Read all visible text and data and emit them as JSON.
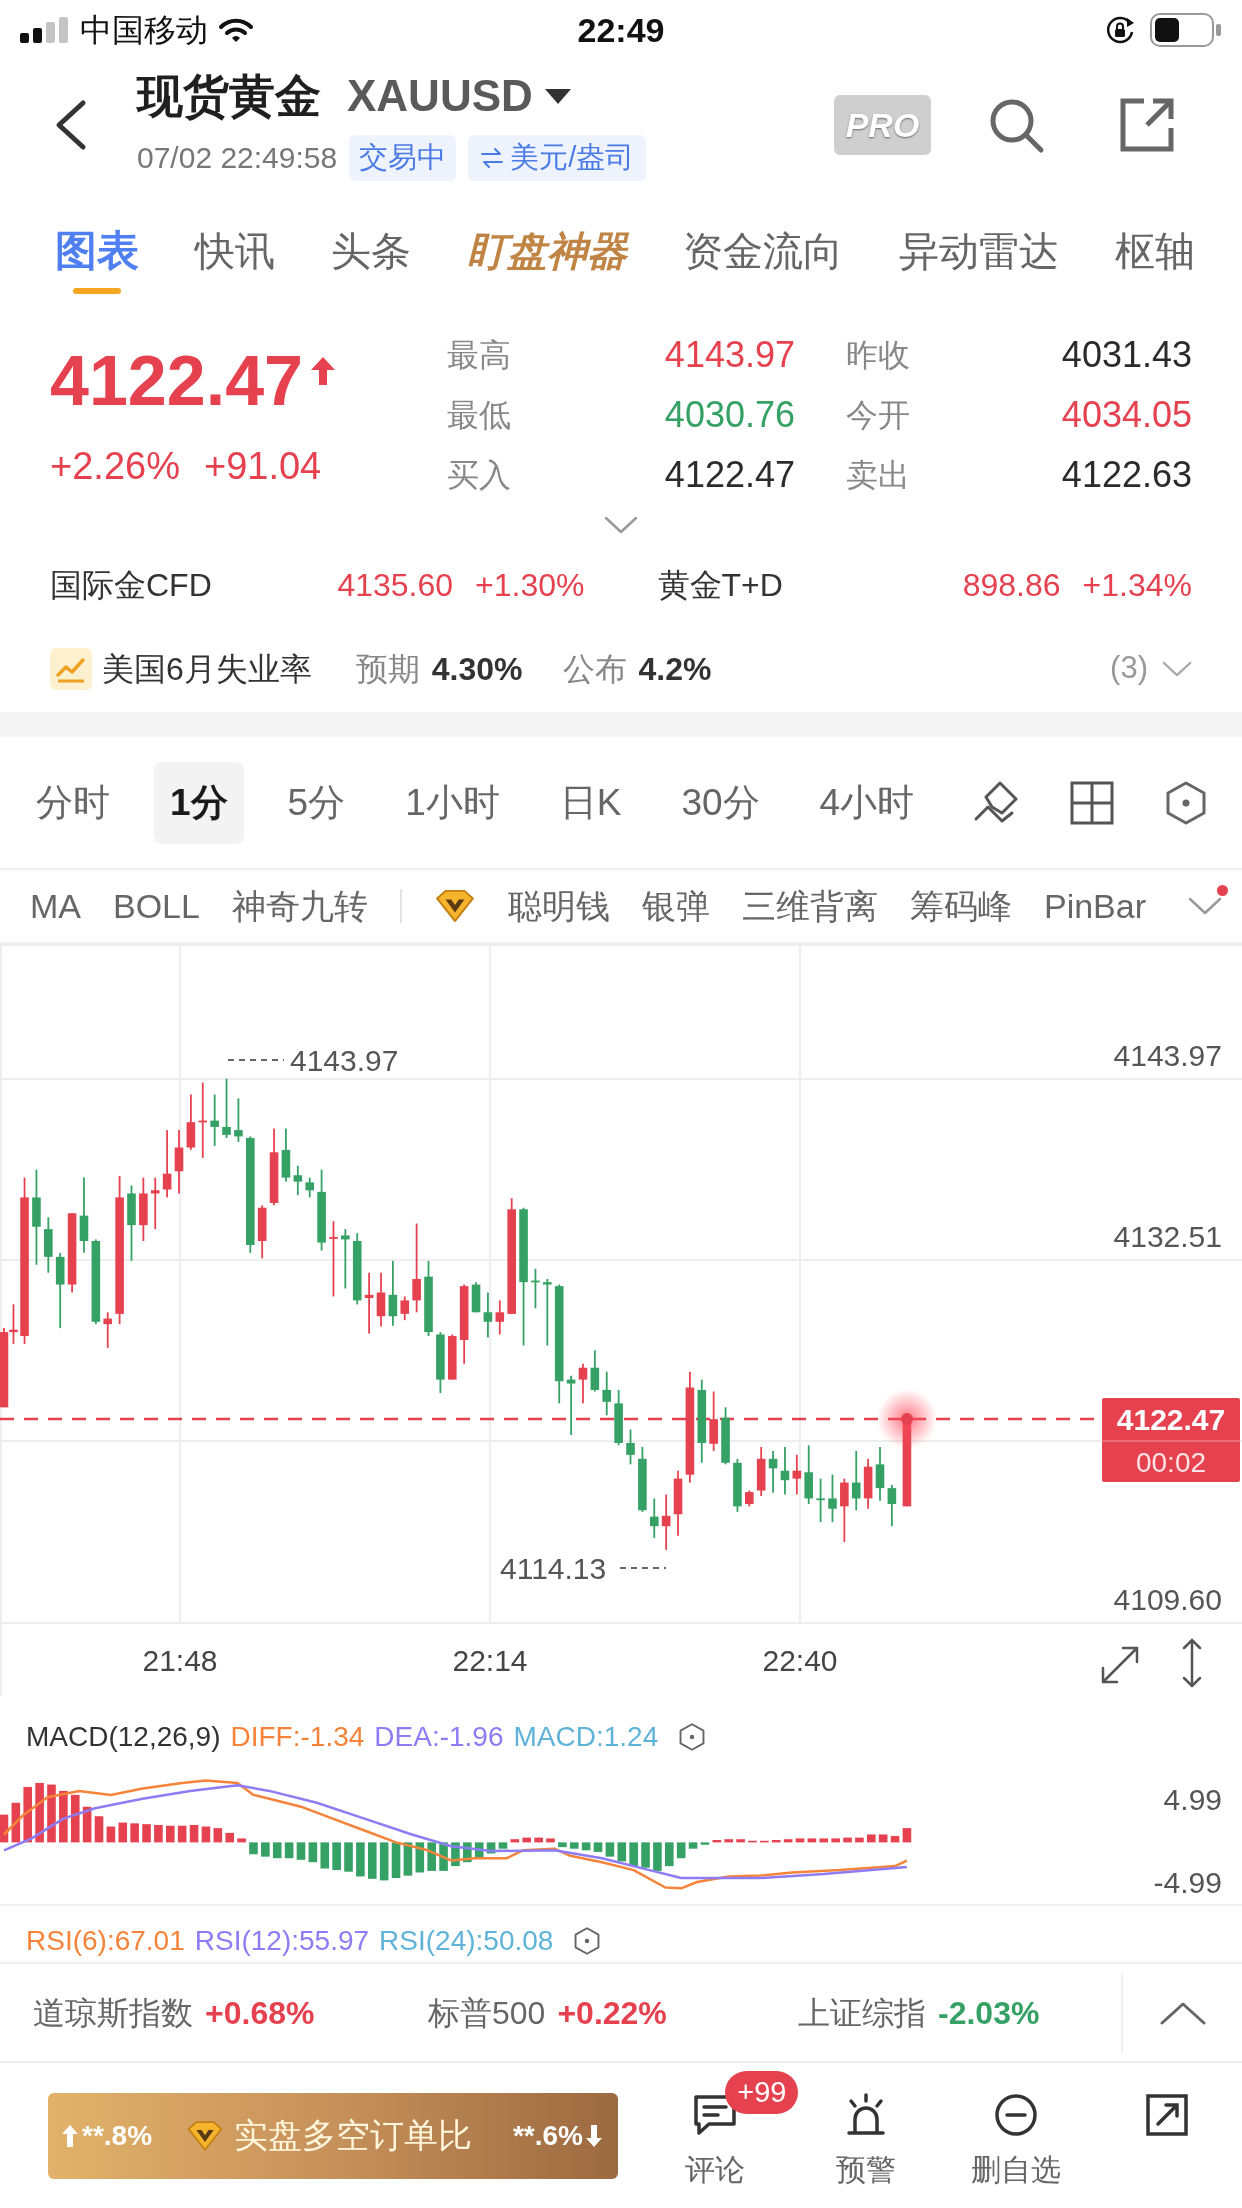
{
  "status_bar": {
    "carrier": "中国移动",
    "time": "22:49"
  },
  "header": {
    "title": "现货黄金",
    "symbol": "XAUUSD",
    "timestamp": "07/02 22:49:58",
    "status_badge": "交易中",
    "unit_badge": "美元/盎司",
    "pro_label": "PRO"
  },
  "tabs": [
    {
      "label": "图表",
      "selected": true,
      "kind": "plain"
    },
    {
      "label": "快讯",
      "selected": false,
      "kind": "plain"
    },
    {
      "label": "头条",
      "selected": false,
      "kind": "plain"
    },
    {
      "label": "盯盘神器",
      "selected": false,
      "kind": "featured"
    },
    {
      "label": "资金流向",
      "selected": false,
      "kind": "plain"
    },
    {
      "label": "异动雷达",
      "selected": false,
      "kind": "plain"
    },
    {
      "label": "枢轴",
      "selected": false,
      "kind": "plain"
    }
  ],
  "quote": {
    "price": "4122.47",
    "rising": true,
    "change_percent": "+2.26%",
    "change": "+91.04",
    "stats": [
      {
        "label": "最高",
        "value": "4143.97",
        "color": "#e6414f"
      },
      {
        "label": "昨收",
        "value": "4031.43",
        "color": "#2b2b2b"
      },
      {
        "label": "最低",
        "value": "4030.76",
        "color": "#35a165"
      },
      {
        "label": "今开",
        "value": "4034.05",
        "color": "#e6414f"
      },
      {
        "label": "买入",
        "value": "4122.47",
        "color": "#2b2b2b"
      },
      {
        "label": "卖出",
        "value": "4122.63",
        "color": "#2b2b2b"
      }
    ]
  },
  "related_markets": [
    {
      "name": "国际金CFD",
      "price": "4135.60",
      "change": "+1.30%",
      "color": "#e6414f"
    },
    {
      "name": "黄金T+D",
      "price": "898.86",
      "change": "+1.34%",
      "color": "#e6414f"
    }
  ],
  "event": {
    "title": "美国6月失业率",
    "expected_label": "预期",
    "expected": "4.30%",
    "actual_label": "公布",
    "actual": "4.2%",
    "count": "(3)"
  },
  "periods": [
    {
      "label": "分时",
      "selected": false
    },
    {
      "label": "1分",
      "selected": true
    },
    {
      "label": "5分",
      "selected": false
    },
    {
      "label": "1小时",
      "selected": false
    },
    {
      "label": "日K",
      "selected": false
    },
    {
      "label": "30分",
      "selected": false
    },
    {
      "label": "4小时",
      "selected": false
    }
  ],
  "indicators": {
    "basic": [
      "MA",
      "BOLL",
      "神奇九转"
    ],
    "premium": [
      "聪明钱",
      "银弹",
      "三维背离",
      "筹码峰",
      "PinBar"
    ],
    "has_new": true
  },
  "chart": {
    "price_axis": [
      "4143.97",
      "4132.51",
      "4109.60"
    ],
    "high_marker": "4143.97",
    "low_marker": "4114.13",
    "last_price": "4122.47",
    "countdown": "00:02",
    "time_axis": [
      "21:48",
      "22:14",
      "22:40"
    ]
  },
  "macd": {
    "title": "MACD(12,26,9)",
    "values": [
      {
        "label": "DIFF:-1.34",
        "color": "#f5843a"
      },
      {
        "label": "DEA:-1.96",
        "color": "#8d7cf3"
      },
      {
        "label": "MACD:1.24",
        "color": "#5fb2d8"
      }
    ],
    "axis": [
      "4.99",
      "-4.99"
    ]
  },
  "rsi": {
    "values": [
      {
        "label": "RSI(6):67.01",
        "color": "#f5843a"
      },
      {
        "label": "RSI(12):55.97",
        "color": "#8d7cf3"
      },
      {
        "label": "RSI(24):50.08",
        "color": "#5fb2d8"
      }
    ]
  },
  "indices": [
    {
      "name": "道琼斯指数",
      "change": "+0.68%",
      "color": "#e6414f"
    },
    {
      "name": "标普500",
      "change": "+0.22%",
      "color": "#e6414f"
    },
    {
      "name": "上证综指",
      "change": "-2.03%",
      "color": "#35a165"
    }
  ],
  "bottom_bar": {
    "long_ratio": "**.8%",
    "sentiment_title": "实盘多空订单比",
    "short_ratio": "**.6%",
    "actions": [
      {
        "kind": "comment",
        "label": "评论",
        "badge": "+99"
      },
      {
        "kind": "alert",
        "label": "预警"
      },
      {
        "kind": "remove",
        "label": "删自选"
      },
      {
        "kind": "share"
      }
    ]
  }
}
